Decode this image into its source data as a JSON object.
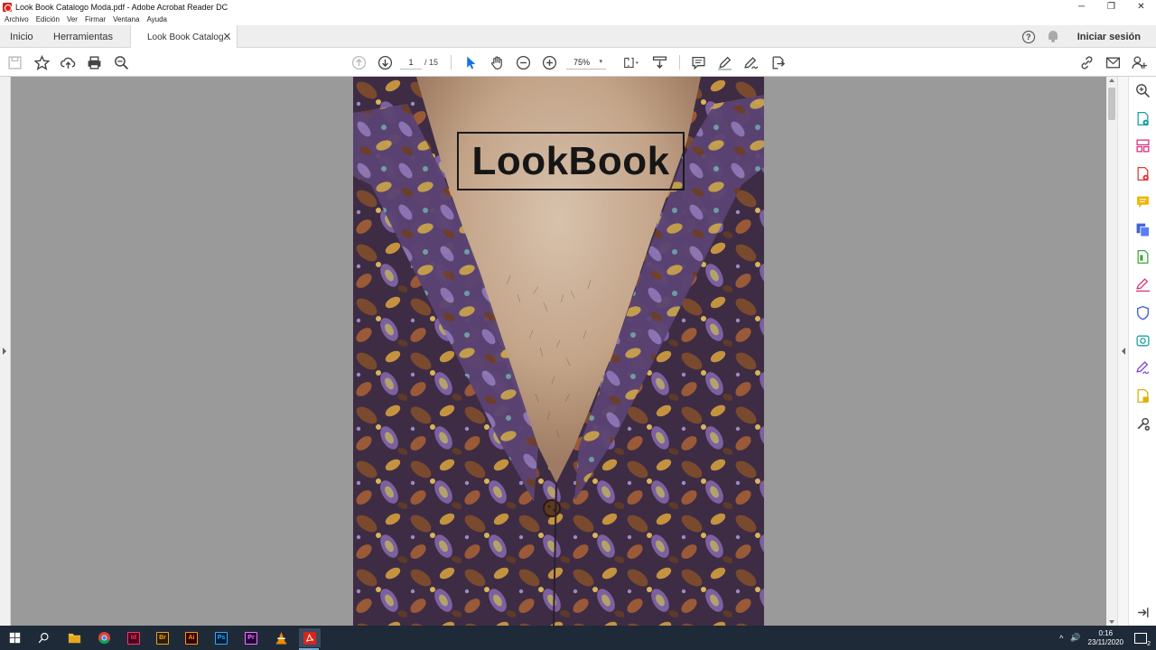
{
  "window": {
    "title": "Look Book Catalogo Moda.pdf - Adobe Acrobat Reader DC",
    "minimize": "─",
    "restore": "❐",
    "close": "✕"
  },
  "menu": [
    "Archivo",
    "Edición",
    "Ver",
    "Firmar",
    "Ventana",
    "Ayuda"
  ],
  "tabs": {
    "home": "Inicio",
    "tools": "Herramientas",
    "document": "Look Book Catalog...",
    "close": "✕"
  },
  "header_right": {
    "help": "?",
    "signin": "Iniciar sesión"
  },
  "toolbar": {
    "page_current": "1",
    "page_total": "/ 15",
    "zoom": "75%",
    "zoom_caret": "▾"
  },
  "document": {
    "cover_title": "LookBook"
  },
  "taskbar": {
    "apps": [
      {
        "name": "Id",
        "bg": "#49021f",
        "fg": "#ff3366"
      },
      {
        "name": "Br",
        "bg": "#2c1d00",
        "fg": "#e7a22a"
      },
      {
        "name": "Ai",
        "bg": "#330000",
        "fg": "#ff9a00"
      },
      {
        "name": "Ps",
        "bg": "#001e36",
        "fg": "#31a8ff"
      },
      {
        "name": "Pr",
        "bg": "#2a003a",
        "fg": "#e77cff"
      }
    ],
    "time": "0:16",
    "date": "23/11/2020",
    "tray_arrow": "^",
    "volume": "🔊",
    "notifications_count": "2"
  },
  "colors": {
    "accent_blue": "#1473e6",
    "acrobat_red": "#d6261c"
  }
}
